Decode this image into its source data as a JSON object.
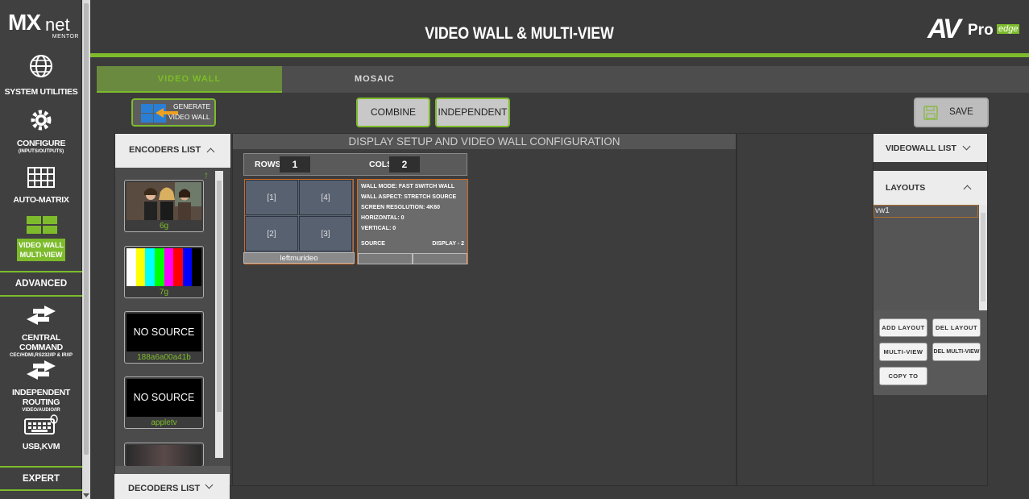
{
  "sidebar": {
    "logo_mx": "MX",
    "logo_net": "net",
    "logo_mentor": "MENTOR",
    "items": [
      {
        "label": "SYSTEM UTILITIES",
        "sub": "",
        "icon": "globe-icon"
      },
      {
        "label": "CONFIGURE",
        "sub": "(INPUTS/OUTPUTS)",
        "icon": "gear-icon"
      },
      {
        "label": "AUTO-MATRIX",
        "sub": "",
        "icon": "grid-icon"
      },
      {
        "label": "VIDEO WALL",
        "label2": "MULTI-VIEW",
        "icon": "video-wall-icon"
      },
      {
        "label": "CENTRAL COMMAND",
        "sub": "CEC/HDMI,RS232/IP & IR/IP",
        "icon": "arrows-icon"
      },
      {
        "label": "INDEPENDENT ROUTING",
        "sub": "VIDEO/AUDIO/IR",
        "icon": "arrows-icon"
      },
      {
        "label": "USB,KVM",
        "sub": "",
        "icon": "keyboard-icon"
      }
    ],
    "section_advanced": "ADVANCED",
    "section_expert": "EXPERT"
  },
  "header": {
    "title": "VIDEO WALL & MULTI-VIEW",
    "brand_av": "AV",
    "brand_pro": "Pro",
    "brand_edge": "edge"
  },
  "tabs": [
    {
      "label": "VIDEO WALL",
      "active": true
    },
    {
      "label": "MOSAIC",
      "active": false
    }
  ],
  "toolbar": {
    "generate_line1": "GENERATE",
    "generate_line2": "VIDEO WALL",
    "combine": "COMBINE",
    "independent": "INDEPENDENT",
    "save": "SAVE"
  },
  "encoders": {
    "title": "ENCODERS LIST",
    "items": [
      {
        "name": "6g",
        "thumb": "people"
      },
      {
        "name": "7g",
        "thumb": "color-bars"
      },
      {
        "name": "188a6a00a41b",
        "thumb": "NO SOURCE"
      },
      {
        "name": "appletv",
        "thumb": "NO SOURCE"
      }
    ]
  },
  "decoders": {
    "title": "DECODERS LIST"
  },
  "config": {
    "title": "DISPLAY SETUP AND VIDEO WALL CONFIGURATION",
    "rows_label": "ROWS",
    "rows_value": "1",
    "cols_label": "COLS",
    "cols_value": "2",
    "cells": [
      "[1]",
      "[4]",
      "[2]",
      "[3]"
    ],
    "wall_name": "leftmurideo",
    "info": {
      "mode": "WALL MODE: FAST SWITCH WALL",
      "aspect": "WALL ASPECT: STRETCH SOURCE",
      "resolution": "SCREEN RESOLUTION: 4K60",
      "horizontal": "HORIZONTAL: 0",
      "vertical": "VERTICAL: 0",
      "source": "SOURCE",
      "display": "DISPLAY - 2"
    }
  },
  "right": {
    "videowall_list": "VIDEOWALL LIST",
    "layouts": "LAYOUTS",
    "layout_items": [
      "vw1"
    ],
    "add_layout": "ADD LAYOUT",
    "del_layout": "DEL LAYOUT",
    "multi_view": "MULTI-VIEW",
    "del_multi_view": "DEL MULTI-VIEW",
    "copy_to": "COPY TO"
  },
  "colors": {
    "accent": "#7dbb2c",
    "highlight": "#d2691e",
    "background": "#3b3b3b"
  }
}
